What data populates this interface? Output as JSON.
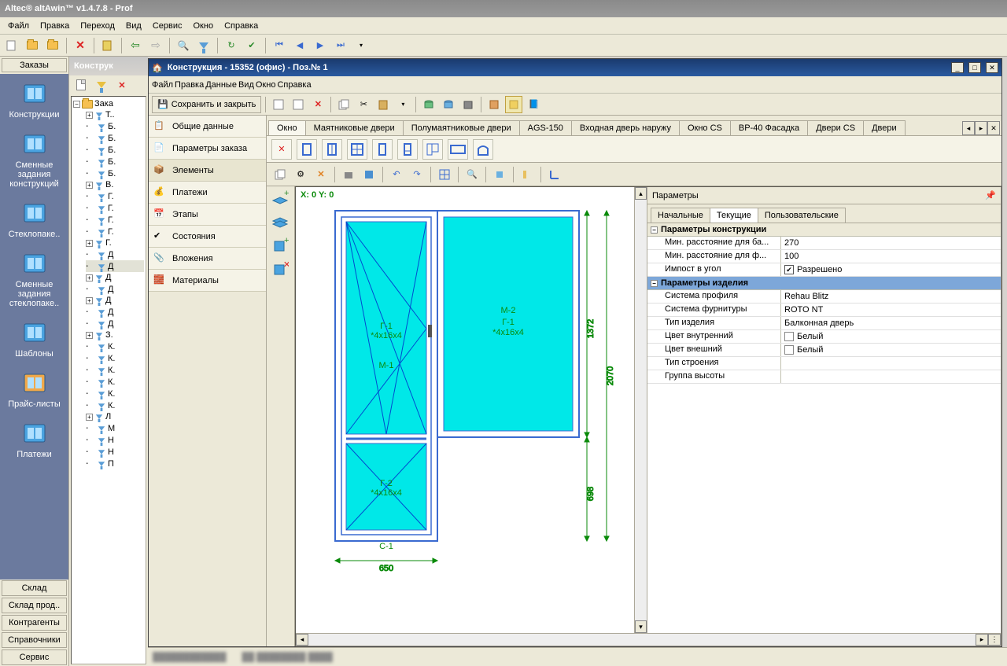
{
  "app_title": "Altec® altAwin™ v1.4.7.8 - Prof",
  "main_menu": [
    "Файл",
    "Правка",
    "Переход",
    "Вид",
    "Сервис",
    "Окно",
    "Справка"
  ],
  "leftbar": {
    "top": "Заказы",
    "items": [
      {
        "label": "Конструкции",
        "color": "#4aa3e0"
      },
      {
        "label": "Сменные задания конструкций",
        "color": "#4aa3e0"
      },
      {
        "label": "Стеклопаке..",
        "color": "#4aa3e0"
      },
      {
        "label": "Сменные задания стеклопаке..",
        "color": "#4aa3e0"
      },
      {
        "label": "Шаблоны",
        "color": "#4aa3e0"
      },
      {
        "label": "Прайс-листы",
        "color": "#f0a84a"
      },
      {
        "label": "Платежи",
        "color": "#4aa3e0"
      }
    ],
    "bottom": [
      "Склад",
      "Склад прод..",
      "Контрагенты",
      "Справочники",
      "Сервис"
    ]
  },
  "mid_panel_title": "Конструк",
  "tree_root": "Зака",
  "tree_items": [
    "Т..",
    "Б.",
    "Б.",
    "Б.",
    "Б.",
    "Б.",
    "В.",
    "Г.",
    "Г.",
    "Г.",
    "Г.",
    "Г.",
    "Д",
    "Д",
    "Д",
    "Д",
    "Д",
    "Д",
    "Д",
    "З.",
    "К.",
    "К.",
    "К.",
    "К.",
    "К.",
    "К.",
    "Л",
    "М",
    "Н",
    "Н",
    "П"
  ],
  "tree_selected_index": 13,
  "subwindow": {
    "title": "Конструкция - 15352 (офис) - Поз.№ 1",
    "menu": [
      "Файл",
      "Правка",
      "Данные",
      "Вид",
      "Окно",
      "Справка"
    ],
    "save_close": "Сохранить и закрыть",
    "sidepanel": [
      "Общие данные",
      "Параметры заказа",
      "Элементы",
      "Платежи",
      "Этапы",
      "Состояния",
      "Вложения",
      "Материалы"
    ],
    "sidepanel_active": 2,
    "tabs": [
      "Окно",
      "Маятниковые двери",
      "Полумаятниковые двери",
      "AGS-150",
      "Входная дверь наружу",
      "Окно CS",
      "BP-40 Фасадка",
      "Двери CS",
      "Двери"
    ],
    "active_tab": 0,
    "xy": "X: 0 Y: 0",
    "drawing": {
      "left_pane": {
        "label1": "Г-1",
        "label2": "*4x16x4",
        "label3": "M-1",
        "label4": "Г-2",
        "label5": "*4x16x4",
        "bottom": "С-1",
        "width": "650"
      },
      "right_pane": {
        "label1": "M-2",
        "label2": "Г-1",
        "label3": "*4x16x4"
      },
      "dims": {
        "h_total": "2070",
        "h_upper": "1372",
        "h_lower": "698"
      }
    },
    "params": {
      "title": "Параметры",
      "tabs": [
        "Начальные",
        "Текущие",
        "Пользовательские"
      ],
      "active_tab": 1,
      "group1": "Параметры конструкции",
      "rows1": [
        {
          "k": "Мин. расстояние для ба...",
          "v": "270"
        },
        {
          "k": "Мин. расстояние для ф...",
          "v": "100"
        },
        {
          "k": "Импост в угол",
          "v": "Разрешено",
          "check": true
        }
      ],
      "group2": "Параметры изделия",
      "rows2": [
        {
          "k": "Система профиля",
          "v": "Rehau Blitz"
        },
        {
          "k": "Система фурнитуры",
          "v": "ROTO NT"
        },
        {
          "k": "Тип изделия",
          "v": "Балконная дверь"
        },
        {
          "k": "Цвет внутренний",
          "v": "Белый",
          "swatch": "#ffffff"
        },
        {
          "k": "Цвет внешний",
          "v": "Белый",
          "swatch": "#ffffff"
        },
        {
          "k": "Тип строения",
          "v": ""
        },
        {
          "k": "Группа высоты",
          "v": ""
        }
      ]
    }
  }
}
